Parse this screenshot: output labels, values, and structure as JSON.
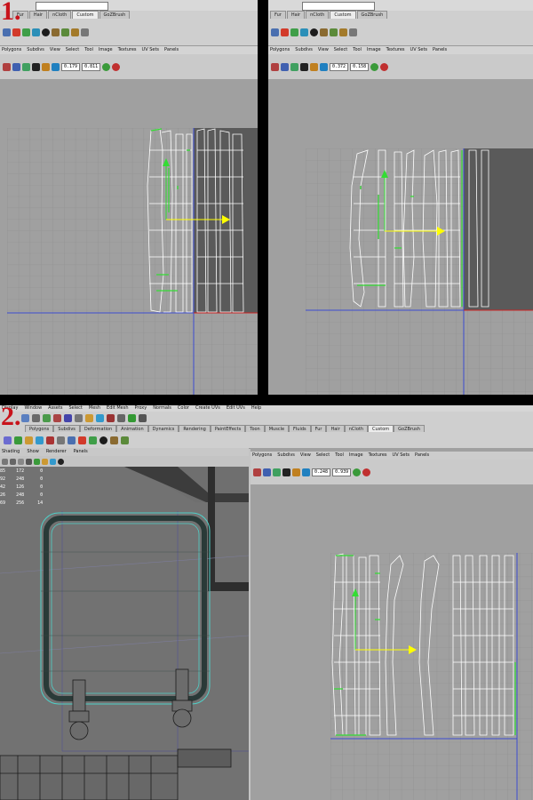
{
  "steps": {
    "one": "1.",
    "two": "2."
  },
  "tabs_short": [
    "Fur",
    "Hair",
    "nCloth",
    "Custom",
    "GoZBrush"
  ],
  "tabs_long": [
    "Polygons",
    "Subdivs",
    "Deformation",
    "Animation",
    "Dynamics",
    "Rendering",
    "PaintEffects",
    "Toon",
    "Muscle",
    "Fluids",
    "Fur",
    "Hair",
    "nCloth",
    "Custom",
    "GoZBrush"
  ],
  "main_menu": [
    "Display",
    "Window",
    "Assets",
    "Select",
    "Mesh",
    "Edit Mesh",
    "Proxy",
    "Normals",
    "Color",
    "Create UVs",
    "Edit UVs",
    "Help"
  ],
  "uv_menu": [
    "Polygons",
    "Subdivs",
    "View",
    "Select",
    "Tool",
    "Image",
    "Textures",
    "UV Sets",
    "Panels"
  ],
  "viewport_menu": [
    "Shading",
    "Show",
    "Renderer",
    "Panels"
  ],
  "uv_coords": {
    "p1": {
      "u": "0.179",
      "v": "0.811"
    },
    "p2": {
      "u": "0.372",
      "v": "0.158"
    },
    "p3": {
      "u": "0.248",
      "v": "0.939"
    }
  },
  "hud_stats": [
    [
      "85",
      "172",
      "0"
    ],
    [
      "92",
      "248",
      "0"
    ],
    [
      "42",
      "126",
      "0"
    ],
    [
      "26",
      "248",
      "0"
    ],
    [
      "69",
      "256",
      "14"
    ]
  ],
  "colors": {
    "accent": "#c8141c",
    "grid_bg": "#a0a0a0",
    "uv_line": "#ffffff",
    "selected_edge": "#33dd33",
    "axis_v": "#3b4bd0",
    "axis_u": "#cc2222",
    "manip_arrow": "#ffff00"
  }
}
